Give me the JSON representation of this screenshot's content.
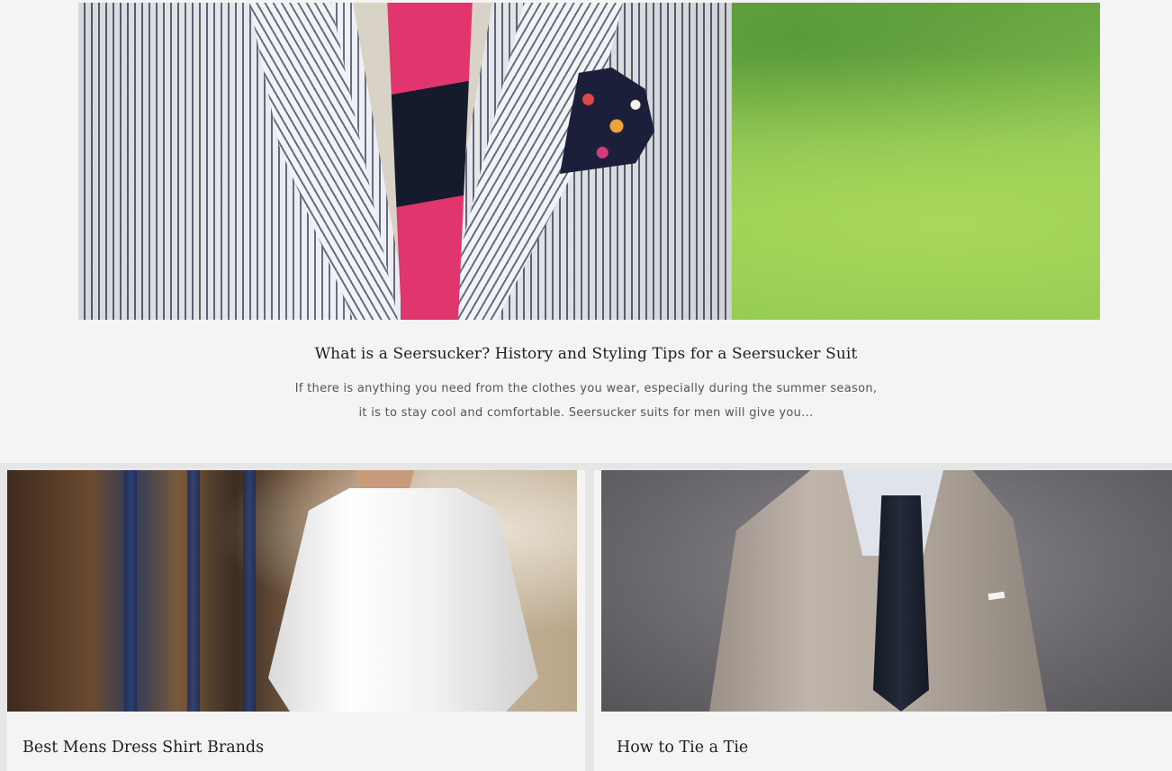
{
  "featured_post": {
    "image_alt": "Man wearing a seersucker suit with pink and navy striped tie and floral pocket square",
    "title": "What is a Seersucker? History and Styling Tips for a Seersucker Suit",
    "excerpt_line1": "If there is anything you need from the clothes you wear, especially during the summer season,",
    "excerpt_line2": "it is to stay cool and comfortable. Seersucker suits for men will give you..."
  },
  "posts": [
    {
      "image_alt": "Man in a white dress shirt on a street",
      "title": "Best Mens Dress Shirt Brands"
    },
    {
      "image_alt": "Man in a grey suit with a navy knit tie",
      "title": "How to Tie a Tie"
    }
  ],
  "colors": {
    "page_background": "#e6e6e6",
    "card_background": "#f4f4f4",
    "title_text": "#1f1f1f",
    "excerpt_text": "#555555"
  }
}
